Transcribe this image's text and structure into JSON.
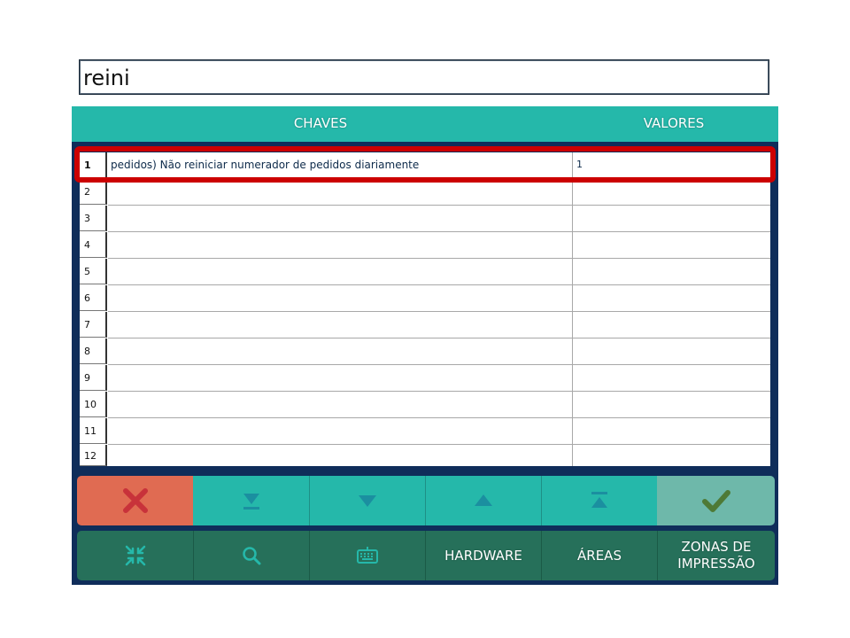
{
  "search": {
    "value": "reini"
  },
  "table": {
    "headers": {
      "keys": "CHAVES",
      "values": "VALORES"
    },
    "rows": [
      {
        "num": "1",
        "key": "pedidos) Não reiniciar numerador de pedidos diariamente",
        "value": "1"
      },
      {
        "num": "2",
        "key": "",
        "value": ""
      },
      {
        "num": "3",
        "key": "",
        "value": ""
      },
      {
        "num": "4",
        "key": "",
        "value": ""
      },
      {
        "num": "5",
        "key": "",
        "value": ""
      },
      {
        "num": "6",
        "key": "",
        "value": ""
      },
      {
        "num": "7",
        "key": "",
        "value": ""
      },
      {
        "num": "8",
        "key": "",
        "value": ""
      },
      {
        "num": "9",
        "key": "",
        "value": ""
      },
      {
        "num": "10",
        "key": "",
        "value": ""
      },
      {
        "num": "11",
        "key": "",
        "value": ""
      },
      {
        "num": "12",
        "key": "",
        "value": ""
      }
    ]
  },
  "nav_buttons": [
    {
      "icon": "close-icon"
    },
    {
      "icon": "last-page-icon"
    },
    {
      "icon": "next-page-icon"
    },
    {
      "icon": "previous-page-icon"
    },
    {
      "icon": "first-page-icon"
    },
    {
      "icon": "checkmark-icon"
    }
  ],
  "function_buttons": {
    "collapse_icon": "collapse-arrows-icon",
    "search_icon": "magnifier-icon",
    "keyboard_icon": "keyboard-icon",
    "hardware": "HARDWARE",
    "areas": "ÁREAS",
    "print_zones_line1": "ZONAS DE",
    "print_zones_line2": "IMPRESSÃO"
  },
  "colors": {
    "header": "#25b8aa",
    "panel": "#0f2d5a",
    "cancel": "#e06b52",
    "confirm": "#6eb8aa",
    "function_bar": "#26705a",
    "selection_highlight": "#cc0000"
  }
}
